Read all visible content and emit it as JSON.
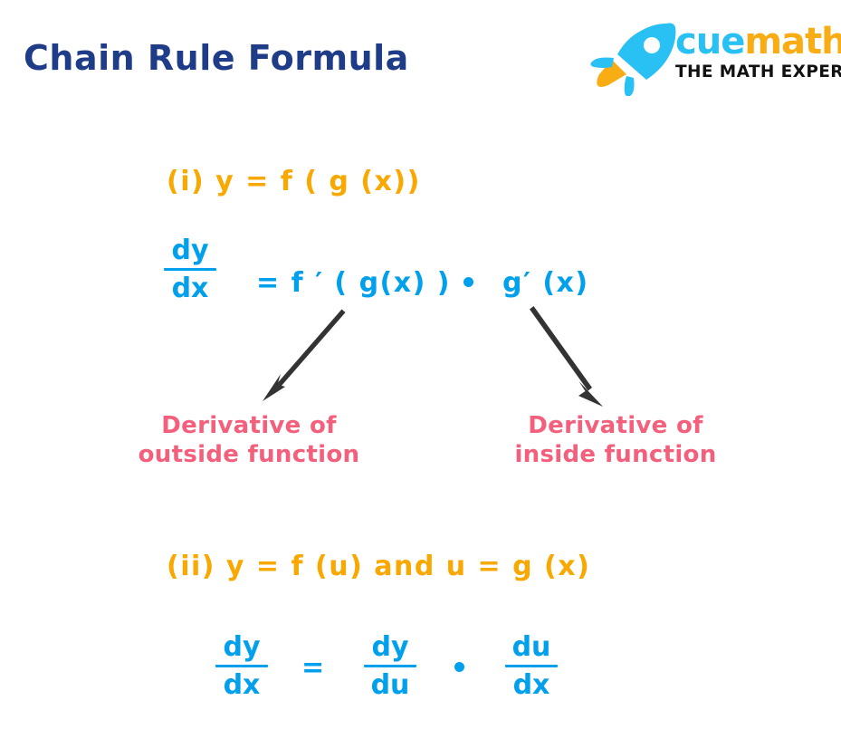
{
  "page": {
    "title": "Chain Rule Formula",
    "background": "#ffffff"
  },
  "logo": {
    "rocket_icon": "rocket-icon",
    "brand_part_1": "cue",
    "brand_part_2": "math",
    "tagline": "THE MATH EXPERT",
    "colors": {
      "cyan": "#29c0f3",
      "orange": "#f8ad15",
      "tagline": "#111111"
    }
  },
  "colors": {
    "title_navy": "#1f3c88",
    "orange": "#f8a800",
    "cyan": "#00a0ec",
    "pink": "#f4607c",
    "arrow": "#333333"
  },
  "formula_one": {
    "statement": "(i) y =  f ( g (x))",
    "derivative": {
      "left_fraction": {
        "numerator": "dy",
        "denominator": "dx"
      },
      "middle": "=  f ′ ( g(x) )",
      "operator": "•",
      "right": "g′ (x)"
    },
    "callouts": {
      "left_line_1": "Derivative of",
      "left_line_2": "outside function",
      "right_line_1": "Derivative of",
      "right_line_2": "inside function"
    }
  },
  "formula_two": {
    "statement": "(ii) y =  f (u) and u =  g (x)",
    "derivative": {
      "fraction_1": {
        "numerator": "dy",
        "denominator": "dx"
      },
      "equals": "=",
      "fraction_2": {
        "numerator": "dy",
        "denominator": "du"
      },
      "operator": "•",
      "fraction_3": {
        "numerator": "du",
        "denominator": "dx"
      }
    }
  }
}
